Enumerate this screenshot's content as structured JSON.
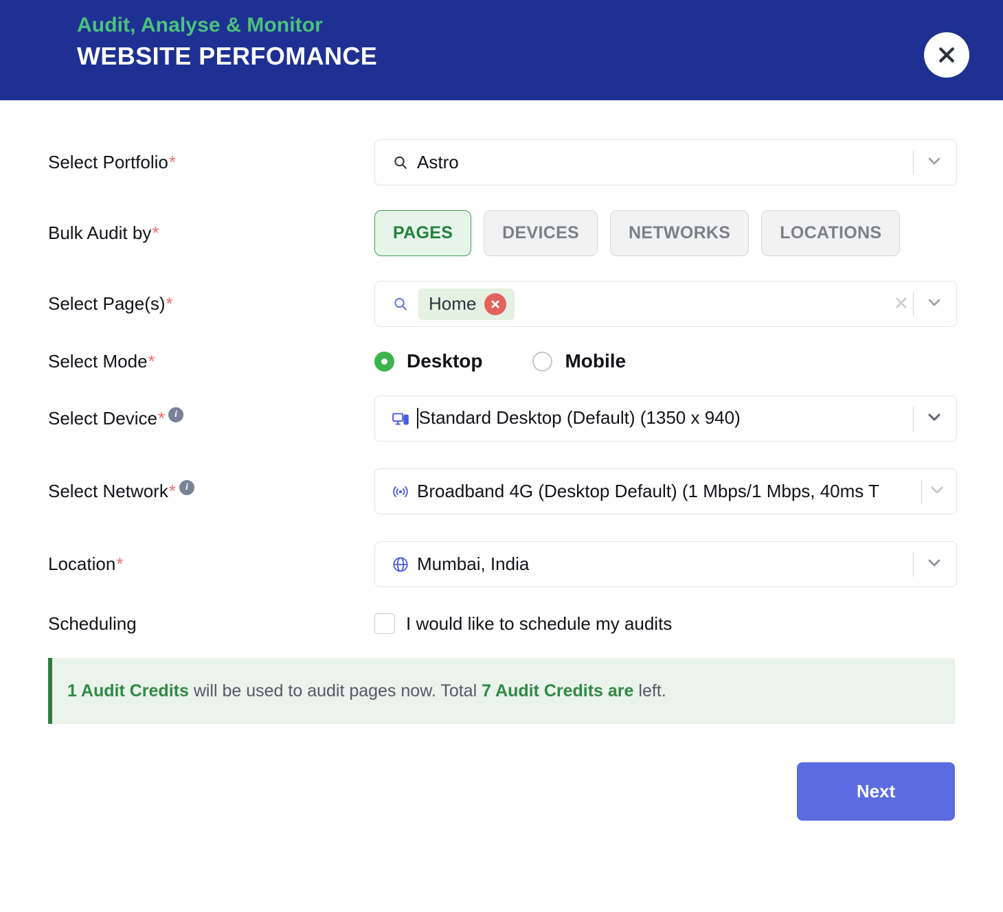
{
  "header": {
    "eyebrow": "Audit, Analyse & Monitor",
    "title": "WEBSITE PERFOMANCE",
    "close_icon": "close-icon",
    "bg_color": "#1e3192",
    "eyebrow_color": "#4cc27c"
  },
  "form": {
    "portfolio": {
      "label": "Select Portfolio",
      "required": "*",
      "icon": "search-icon",
      "value": "Astro",
      "chevron_icon": "chevron-down-icon"
    },
    "bulk_audit": {
      "label": "Bulk Audit by",
      "required": "*",
      "options": [
        {
          "label": "PAGES",
          "active": true
        },
        {
          "label": "DEVICES",
          "active": false
        },
        {
          "label": "NETWORKS",
          "active": false
        },
        {
          "label": "LOCATIONS",
          "active": false
        }
      ],
      "active_color": "#22823a"
    },
    "pages": {
      "label": "Select Page(s)",
      "required": "*",
      "icon": "search-icon",
      "chips": [
        {
          "label": "Home",
          "remove_icon": "chip-remove-icon"
        }
      ],
      "clear_label": "✕",
      "chevron_icon": "chevron-down-icon"
    },
    "mode": {
      "label": "Select Mode",
      "required": "*",
      "options": [
        {
          "label": "Desktop",
          "selected": true
        },
        {
          "label": "Mobile",
          "selected": false
        }
      ],
      "selected_color": "#3bb54a"
    },
    "device": {
      "label": "Select Device",
      "required": "*",
      "info_icon": "info-icon",
      "info_glyph": "i",
      "icon": "desktop-device-icon",
      "value": "Standard Desktop (Default) (1350 x 940)",
      "chevron_icon": "chevron-down-icon"
    },
    "network": {
      "label": "Select Network",
      "required": "*",
      "info_icon": "info-icon",
      "info_glyph": "i",
      "icon": "network-signal-icon",
      "value": "Broadband 4G (Desktop Default) (1 Mbps/1 Mbps, 40ms T",
      "chevron_icon": "chevron-down-icon"
    },
    "location": {
      "label": "Location",
      "required": "*",
      "icon": "globe-icon",
      "value": "Mumbai, India",
      "chevron_icon": "chevron-down-icon"
    },
    "scheduling": {
      "label": "Scheduling",
      "checkbox_label": "I would like to schedule my audits",
      "checked": false
    }
  },
  "credits": {
    "used_amount": "1 Audit Credits",
    "middle_text": " will be used to audit pages now. Total ",
    "remaining_amount": "7 Audit Credits are",
    "tail_text": " left.",
    "accent_color": "#2f8a43",
    "border_color": "#2f7d3f"
  },
  "footer": {
    "next_label": "Next",
    "next_color": "#5b6be0"
  }
}
